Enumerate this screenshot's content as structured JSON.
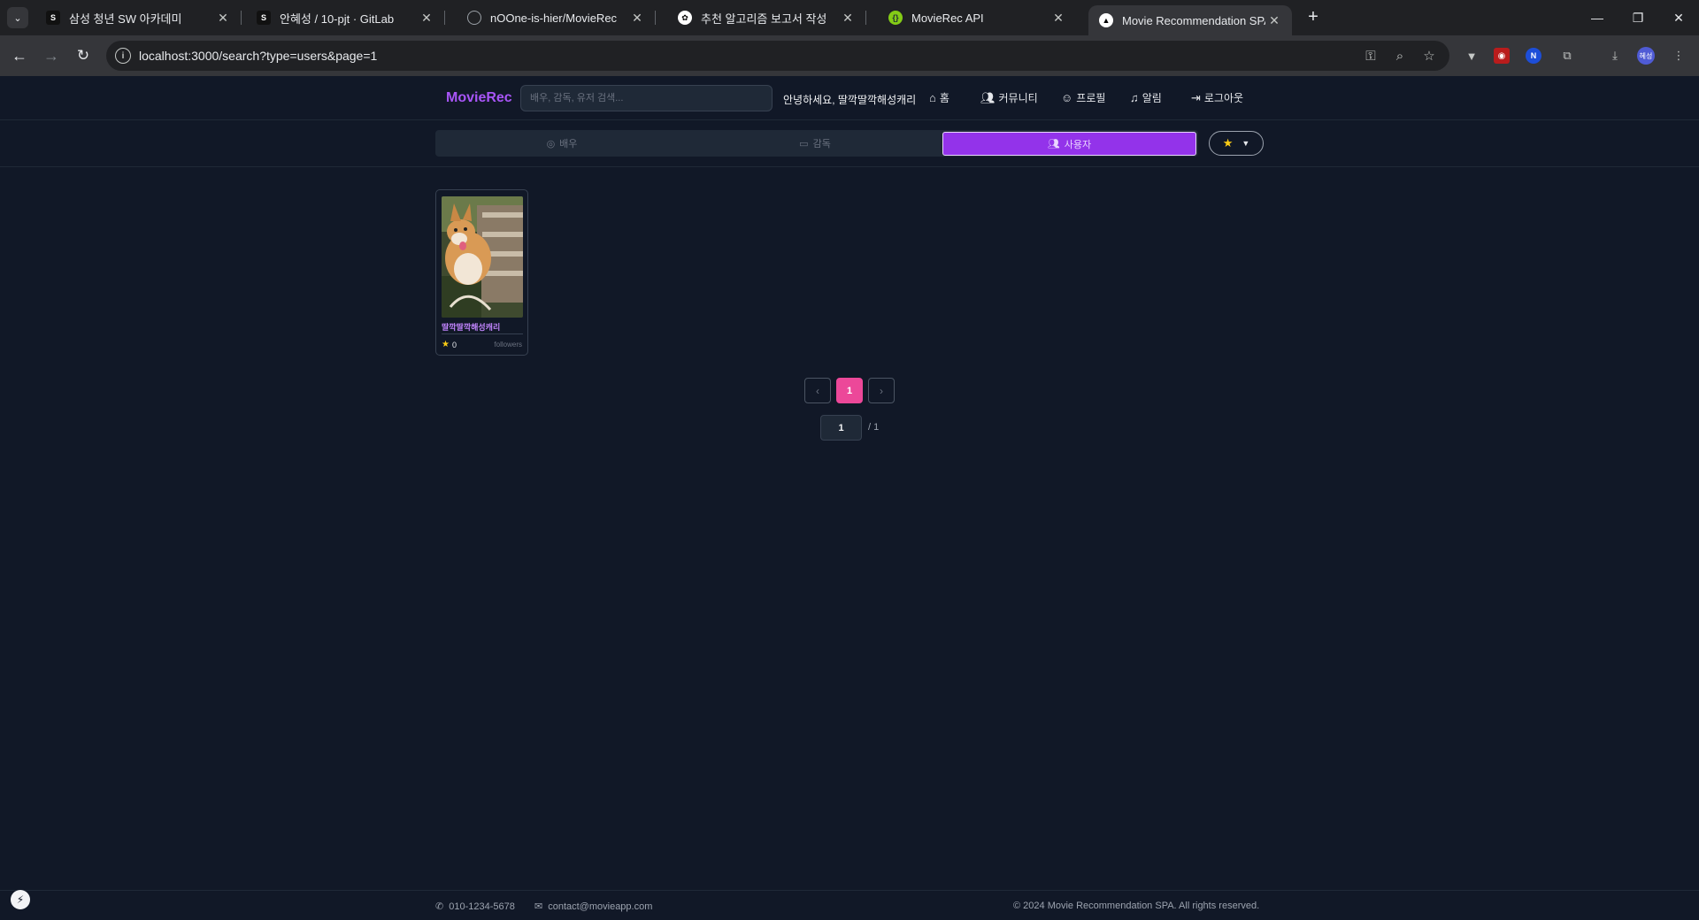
{
  "browser": {
    "tabs": [
      {
        "title": "삼성 청년 SW 아카데미",
        "favicon": "ssafy-icon"
      },
      {
        "title": "안혜성 / 10-pjt · GitLab",
        "favicon": "gitlab-icon"
      },
      {
        "title": "nOOne-is-hier/MovieRec",
        "favicon": "github-icon"
      },
      {
        "title": "추천 알고리즘 보고서 작성",
        "favicon": "chatgpt-icon"
      },
      {
        "title": "MovieRec API",
        "favicon": "api-icon"
      },
      {
        "title": "Movie Recommendation SPA",
        "favicon": "nuxt-icon"
      }
    ],
    "url": "localhost:3000/search?type=users&page=1",
    "profile_initials": "혜성"
  },
  "header": {
    "logo": "MovieRec",
    "search_placeholder": "배우, 감독, 유저 검색...",
    "greeting": "안녕하세요, 딸깍딸깍해성캐리",
    "nav": [
      {
        "label": "홈",
        "icon": "home-icon"
      },
      {
        "label": "커뮤니티",
        "icon": "users-icon"
      },
      {
        "label": "프로필",
        "icon": "user-icon"
      },
      {
        "label": "알림",
        "icon": "bell-icon"
      },
      {
        "label": "로그아웃",
        "icon": "logout-icon"
      }
    ]
  },
  "search_types": [
    {
      "label": "배우",
      "icon": "actor-icon",
      "active": false
    },
    {
      "label": "감독",
      "icon": "camera-icon",
      "active": false
    },
    {
      "label": "사용자",
      "icon": "users-icon",
      "active": true
    }
  ],
  "sort": {
    "icon": "star-icon",
    "color": "#facc15"
  },
  "results": [
    {
      "username": "딸깍딸깍해성캐리",
      "rating": "0",
      "followers_label": "followers"
    }
  ],
  "pagination": {
    "prev": "‹",
    "current": "1",
    "next": "›",
    "input_value": "1",
    "total": "/ 1"
  },
  "footer": {
    "phone": "010-1234-5678",
    "email": "contact@movieapp.com",
    "copyright": "© 2024 Movie Recommendation SPA. All rights reserved."
  },
  "colors": {
    "background": "#111827",
    "accent": "#9333ea",
    "brand": "#a855f7",
    "page_active": "#ec4899"
  }
}
